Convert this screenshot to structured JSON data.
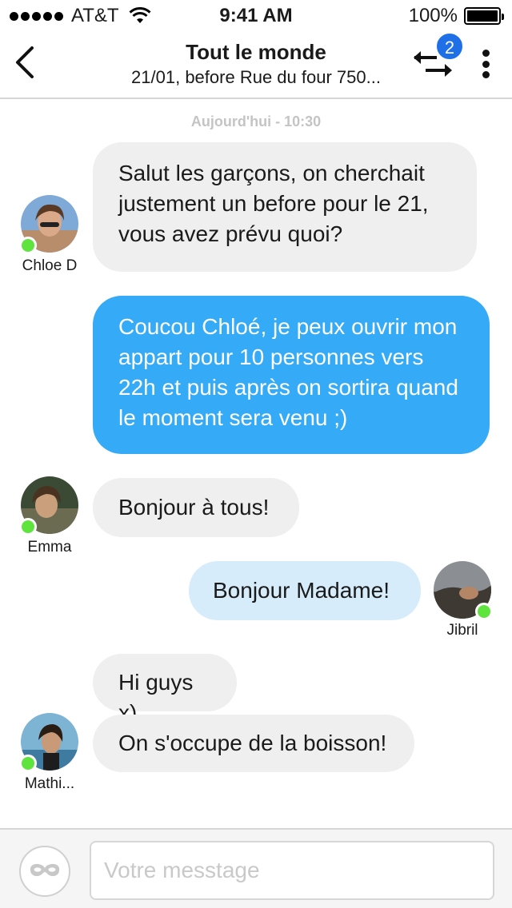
{
  "status_bar": {
    "carrier": "AT&T",
    "time": "9:41 AM",
    "battery": "100%"
  },
  "header": {
    "title": "Tout le monde",
    "subtitle": "21/01, before Rue du four 750...",
    "swap_badge_count": "2"
  },
  "chat": {
    "date_separator": "Aujourd'hui - 10:30",
    "messages": [
      {
        "sender": "Chloe D",
        "direction": "in",
        "text": "Salut les garçons, on cherchait justement un before pour le 21, vous avez prévu quoi?"
      },
      {
        "sender": "me",
        "direction": "out",
        "text": "Coucou Chloé, je peux ouvrir mon appart pour 10 personnes vers 22h et puis après on sortira quand le moment sera venu ;)"
      },
      {
        "sender": "Emma",
        "direction": "in",
        "text": "Bonjour à tous!"
      },
      {
        "sender": "Jibril",
        "direction": "out",
        "text": "Bonjour Madame!"
      },
      {
        "sender": "Mathi...",
        "direction": "in",
        "text": "Hi guys x)"
      },
      {
        "sender": "Mathi...",
        "direction": "in",
        "text": "On s'occupe de la boisson!"
      }
    ]
  },
  "input": {
    "placeholder": "Votre messtage"
  },
  "colors": {
    "bubble_out": "#35aaf7",
    "bubble_out_light": "#d7ecfb",
    "bubble_in": "#efefef",
    "online": "#5ee43d",
    "badge": "#1f6fe6"
  },
  "icons": {
    "back": "chevron-left-icon",
    "swap": "swap-arrows-icon",
    "more": "vertical-dots-icon",
    "mask": "mask-icon",
    "wifi": "wifi-icon",
    "battery": "battery-icon"
  }
}
